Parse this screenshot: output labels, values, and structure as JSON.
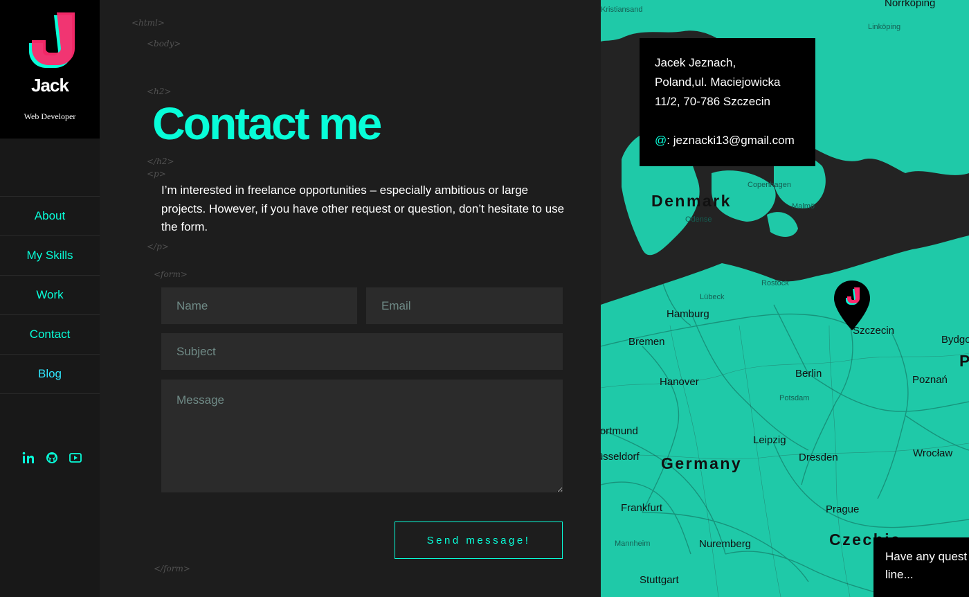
{
  "brand": {
    "initial": "J",
    "name": "Jack",
    "subtitle": "Web Developer"
  },
  "nav": {
    "items": [
      {
        "label": "About"
      },
      {
        "label": "My Skills"
      },
      {
        "label": "Work"
      },
      {
        "label": "Contact"
      },
      {
        "label": "Blog"
      }
    ]
  },
  "social": {
    "icons": [
      "linkedin-icon",
      "github-icon",
      "youtube-icon"
    ]
  },
  "tags": {
    "html_open": "<html>",
    "body_open": "<body>",
    "h2_open": "<h2>",
    "h2_close": "</h2>",
    "p_open": "<p>",
    "p_close": "</p>",
    "form_open": "<form>",
    "form_close": "</form>"
  },
  "headline": "Contact me",
  "intro": "I’m interested in freelance opportunities – especially ambitious or large projects. However, if you have other request or question, don’t hesitate to use the form.",
  "form": {
    "name_placeholder": "Name",
    "email_placeholder": "Email",
    "subject_placeholder": "Subject",
    "message_placeholder": "Message",
    "send_label": "Send message!"
  },
  "address": {
    "line1": "Jacek Jeznach,",
    "line2": "Poland,ul. Maciejowicka",
    "line3": "11/2, 70-786 Szczecin",
    "email_prefix": "@",
    "email": ": jeznacki13@gmail.com"
  },
  "map": {
    "countries": [
      "Denmark",
      "Germany",
      "Czechia"
    ],
    "cities": [
      "Norrköping",
      "Kristiansand",
      "Linköping",
      "Copenhagen",
      "Malmö",
      "Odense",
      "Rostock",
      "Lübeck",
      "Hamburg",
      "Bremen",
      "Szczecin",
      "Bydgoszcz",
      "Hanover",
      "Berlin",
      "Potsdam",
      "Poznań",
      "Dortmund",
      "Leipzig",
      "Düsseldorf",
      "Dresden",
      "Wrocław",
      "Frankfurt",
      "Prague",
      "Mannheim",
      "Nuremberg",
      "Stuttgart",
      "P"
    ],
    "accent": "#08fdd8",
    "land_color": "#1fc9a8",
    "water_color": "#232323"
  },
  "chat": {
    "line1": "Have any quest",
    "line2": "line..."
  },
  "colors": {
    "accent": "#08fdd8",
    "logo_pink": "#fe2a6d",
    "logo_cyan": "#08fdd8",
    "background": "#1d1d1d"
  }
}
